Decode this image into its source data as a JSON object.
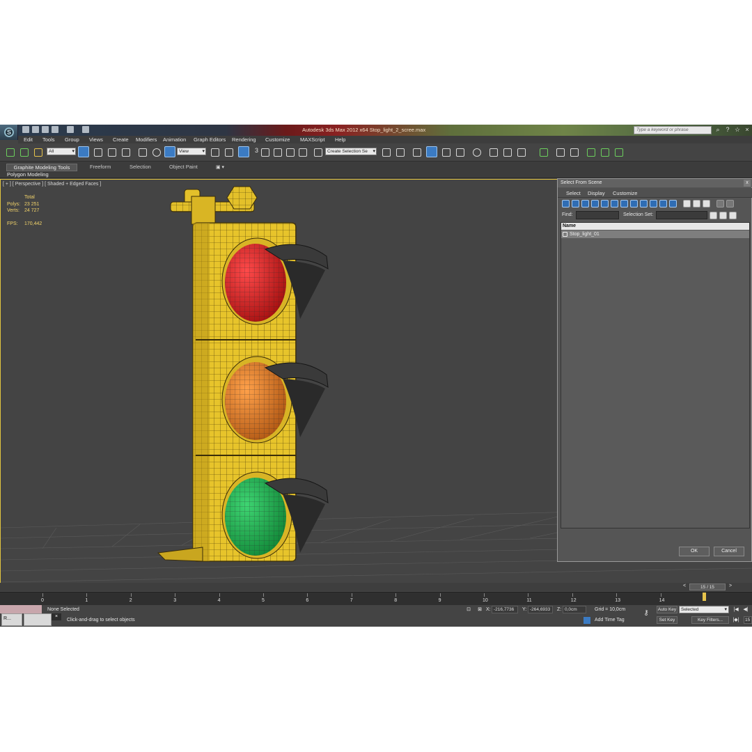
{
  "window": {
    "title": "Autodesk 3ds Max  2012 x64    Stop_light_2_scree.max",
    "search_placeholder": "Type a keyword or phrase"
  },
  "menu": [
    "Edit",
    "Tools",
    "Group",
    "Views",
    "Create",
    "Modifiers",
    "Animation",
    "Graph Editors",
    "Rendering",
    "Customize",
    "MAXScript",
    "Help"
  ],
  "toolbar": {
    "filter_value": "All",
    "coord_system": "View",
    "snap_digit": "3",
    "named_selection": "Create Selection Se"
  },
  "ribbon": {
    "tabs": [
      "Graphite Modeling Tools",
      "Freeform",
      "Selection",
      "Object Paint"
    ],
    "panel_label": "Polygon Modeling"
  },
  "viewport": {
    "label": "[ + ] [ Perspective ] [ Shaded + Edged Faces ]",
    "stats": {
      "total_label": "Total",
      "polys_label": "Polys:",
      "polys_value": "23 251",
      "verts_label": "Verts:",
      "verts_value": "24 727",
      "fps_label": "FPS:",
      "fps_value": "170,442"
    }
  },
  "dialog": {
    "title": "Select From Scene",
    "close": "x",
    "menu": [
      "Select",
      "Display",
      "Customize"
    ],
    "find_label": "Find:",
    "selection_set_label": "Selection Set:",
    "column_header": "Name",
    "items": [
      "Stop_light_01"
    ],
    "ok_label": "OK",
    "cancel_label": "Cancel"
  },
  "timeline": {
    "frame_slider": "15 / 15",
    "ticks": [
      "0",
      "1",
      "2",
      "3",
      "4",
      "5",
      "6",
      "7",
      "8",
      "9",
      "10",
      "11",
      "12",
      "13",
      "14"
    ]
  },
  "status": {
    "selection_text": "None Selected",
    "prompt": "Click-and-drag to select objects",
    "x_label": "X:",
    "x_value": "-216,7736",
    "y_label": "Y:",
    "y_value": "-264,6933",
    "z_label": "Z:",
    "z_value": "0,0cm",
    "grid": "Grid = 10,0cm",
    "add_time_tag": "Add Time Tag",
    "auto_key": "Auto Key",
    "set_key": "Set Key",
    "key_mode": "Selected",
    "key_filters": "Key Filters...",
    "current_frame": "15",
    "taskbar_label": "R..."
  },
  "colors": {
    "accent_blue": "#3b7bc3",
    "viewport_bg": "#444444",
    "model_yellow": "#e7c42b",
    "lamp_red": "#d42020",
    "lamp_amber": "#e0822a",
    "lamp_green": "#1fb24e",
    "stats_text": "#f2d36a"
  },
  "icons": [
    "app-logo-icon",
    "search-icon",
    "help-icon",
    "minimize-icon",
    "maximize-icon",
    "close-icon",
    "select-icon",
    "move-icon",
    "rotate-icon",
    "scale-icon",
    "key-icon",
    "lock-icon",
    "play-icon"
  ]
}
